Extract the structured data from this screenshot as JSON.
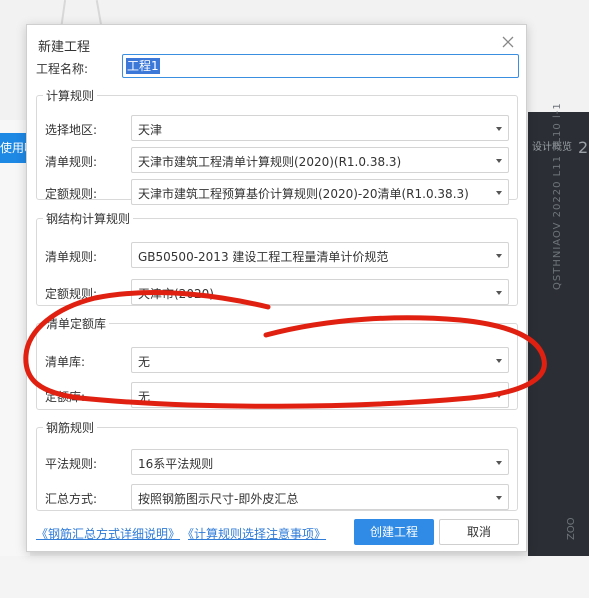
{
  "background": {
    "left_blue_text": "使用吧以",
    "right_panel_title": "设计概览",
    "right_panel_num": "2",
    "right_vertical_text": "QSTHNIAOV 20220 L11 2L10 l-1",
    "right_vertical_text2": "ZOO"
  },
  "dialog": {
    "title": "新建工程",
    "name_label": "工程名称:",
    "name_value": "工程1"
  },
  "groups": {
    "calc_rules": {
      "legend": "计算规则",
      "rows": [
        {
          "label": "选择地区:",
          "value": "天津"
        },
        {
          "label": "清单规则:",
          "value": "天津市建筑工程清单计算规则(2020)(R1.0.38.3)"
        },
        {
          "label": "定额规则:",
          "value": "天津市建筑工程预算基价计算规则(2020)-20清单(R1.0.38.3)"
        }
      ]
    },
    "steel_rules": {
      "legend": "钢结构计算规则",
      "rows": [
        {
          "label": "清单规则:",
          "value": "GB50500-2013 建设工程工程量清单计价规范"
        },
        {
          "label": "定额规则:",
          "value": "天津市(2020)"
        }
      ]
    },
    "quota_lib": {
      "legend": "清单定额库",
      "rows": [
        {
          "label": "清单库:",
          "value": "无"
        },
        {
          "label": "定额库:",
          "value": "无"
        }
      ]
    },
    "rebar_rules": {
      "legend": "钢筋规则",
      "rows": [
        {
          "label": "平法规则:",
          "value": "16系平法规则"
        },
        {
          "label": "汇总方式:",
          "value": "按照钢筋图示尺寸-即外皮汇总"
        }
      ]
    }
  },
  "footer": {
    "link1": "《钢筋汇总方式详细说明》",
    "link2": "《计算规则选择注意事项》",
    "create_label": "创建工程",
    "cancel_label": "取消"
  },
  "colors": {
    "accent": "#2f8be6",
    "annotation": "#e02010"
  }
}
